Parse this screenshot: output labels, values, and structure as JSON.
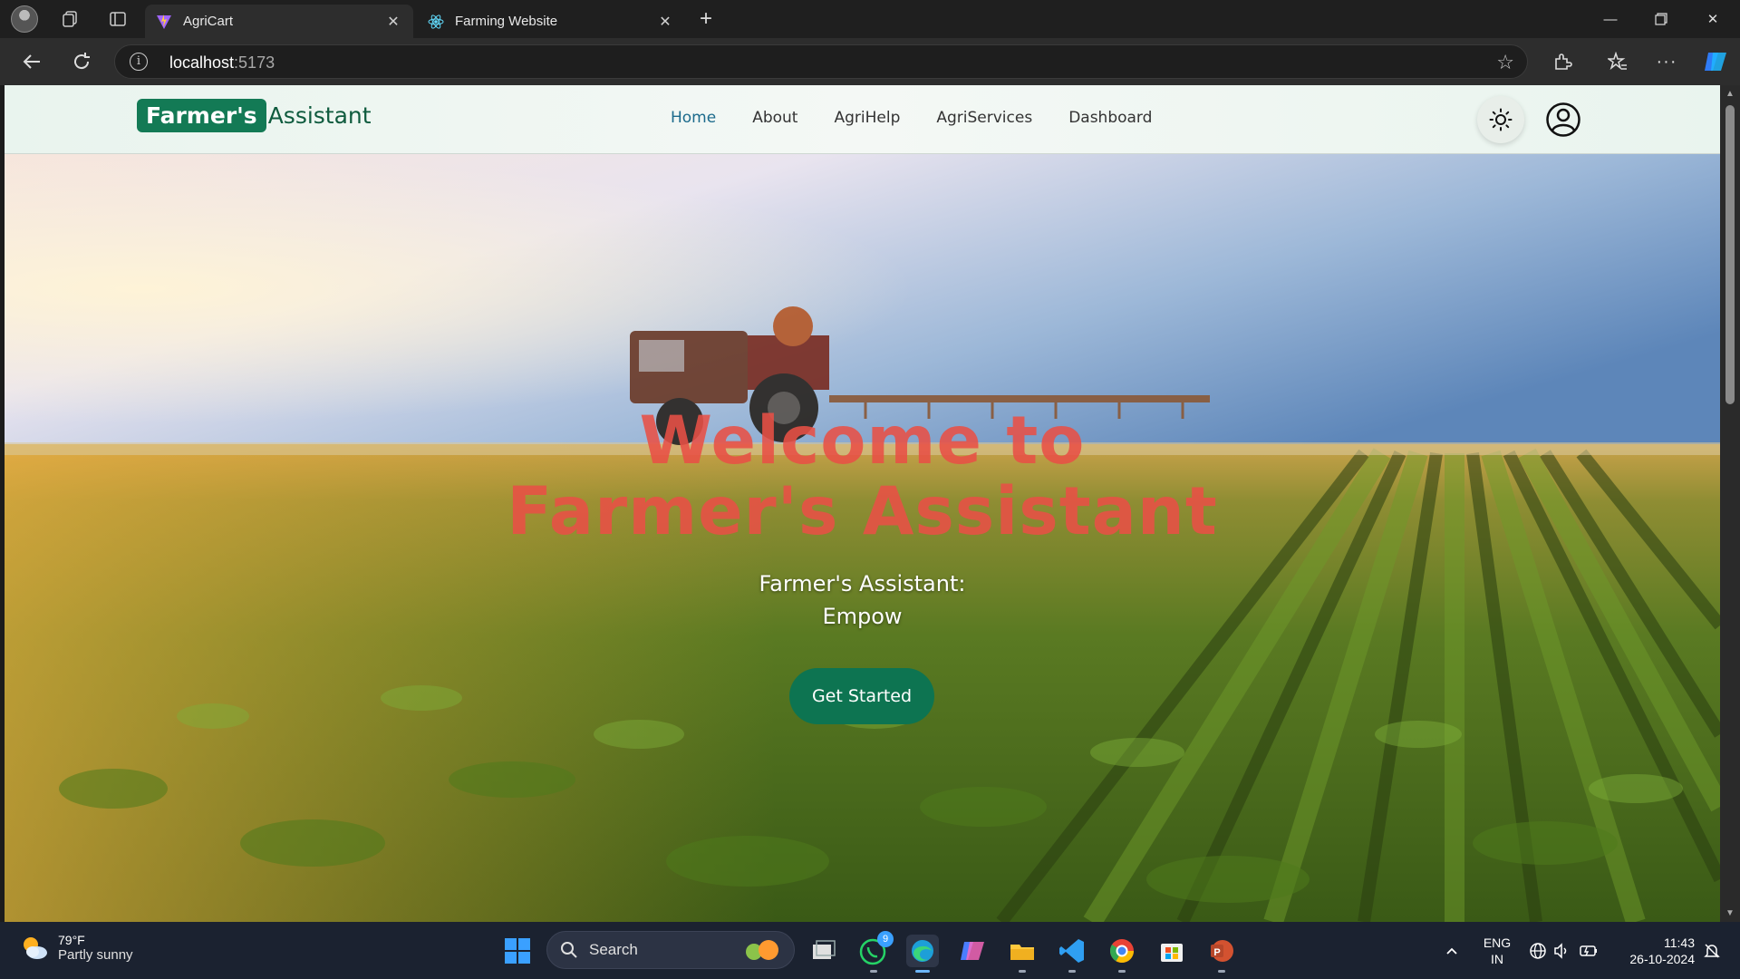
{
  "browser": {
    "tabs": [
      {
        "title": "AgriCart",
        "active": true
      },
      {
        "title": "Farming Website",
        "active": false
      }
    ],
    "address": {
      "host": "localhost",
      "port": ":5173"
    }
  },
  "navbar": {
    "logo_badge": "Farmer's",
    "logo_rest": "Assistant",
    "links": [
      {
        "label": "Home",
        "active": true
      },
      {
        "label": "About"
      },
      {
        "label": "AgriHelp"
      },
      {
        "label": "AgriServices"
      },
      {
        "label": "Dashboard"
      }
    ]
  },
  "hero": {
    "title_line1": "Welcome to",
    "title_line2": "Farmer's Assistant",
    "subtitle_line1": "Farmer's Assistant:",
    "subtitle_line2": "Empow",
    "cta_label": "Get Started"
  },
  "taskbar": {
    "weather_temp": "79°F",
    "weather_cond": "Partly sunny",
    "search_placeholder": "Search",
    "whatsapp_badge": "9",
    "lang_line1": "ENG",
    "lang_line2": "IN",
    "time": "11:43",
    "date": "26-10-2024"
  },
  "colors": {
    "brand_green": "#137a55",
    "nav_active": "#1c6a8c",
    "hero_title": "#e85046",
    "cta": "#0d7451"
  }
}
